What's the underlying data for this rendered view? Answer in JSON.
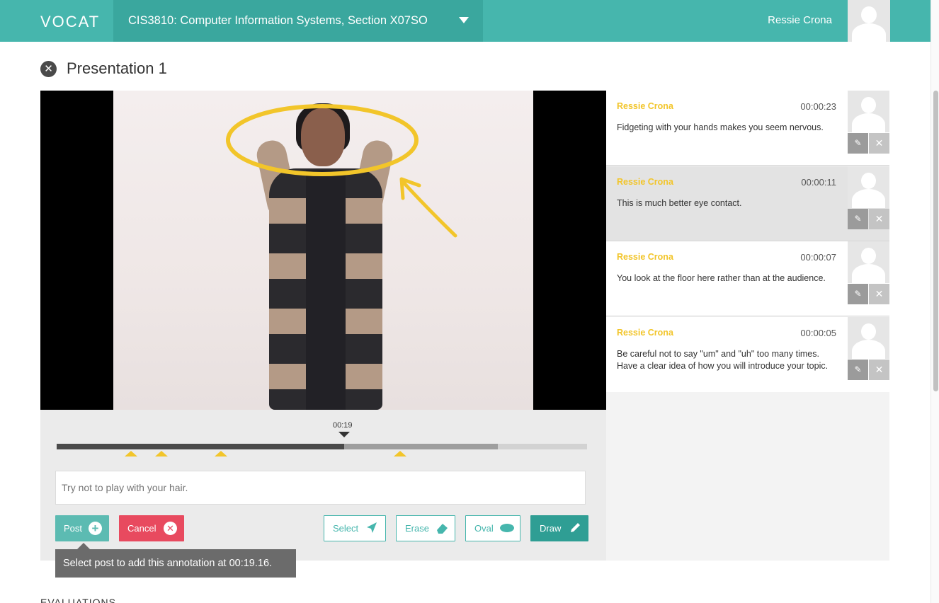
{
  "header": {
    "logo": "VOCAT",
    "course": "CIS3810: Computer Information Systems, Section X07SO",
    "user_name": "Ressie Crona"
  },
  "page": {
    "title": "Presentation 1"
  },
  "player": {
    "current_time": "00:19",
    "played_fraction": 0.542,
    "buffered_fraction": 0.832,
    "marker_times": [
      "00:05",
      "00:07",
      "00:11",
      "00:23"
    ],
    "annotation_placeholder": "Try not to play with your hair."
  },
  "buttons": {
    "post": "Post",
    "cancel": "Cancel",
    "select": "Select",
    "erase": "Erase",
    "oval": "Oval",
    "draw": "Draw"
  },
  "tooltip": "Select post to add this annotation at 00:19.16.",
  "sections": {
    "evaluations": "EVALUATIONS"
  },
  "comments": [
    {
      "author": "Ressie Crona",
      "time": "00:00:23",
      "text": "Fidgeting with your hands makes you seem nervous."
    },
    {
      "author": "Ressie Crona",
      "time": "00:00:11",
      "text": "This is much better eye contact."
    },
    {
      "author": "Ressie Crona",
      "time": "00:00:07",
      "text": "You look at the floor here rather than at the audience."
    },
    {
      "author": "Ressie Crona",
      "time": "00:00:05",
      "text": "Be careful not to say \"um\" and \"uh\" too many times. Have a clear idea of how you will introduce your topic."
    }
  ],
  "colors": {
    "brand": "#46b6ad",
    "accent_yellow": "#f2c52a",
    "danger": "#e84a5f"
  }
}
